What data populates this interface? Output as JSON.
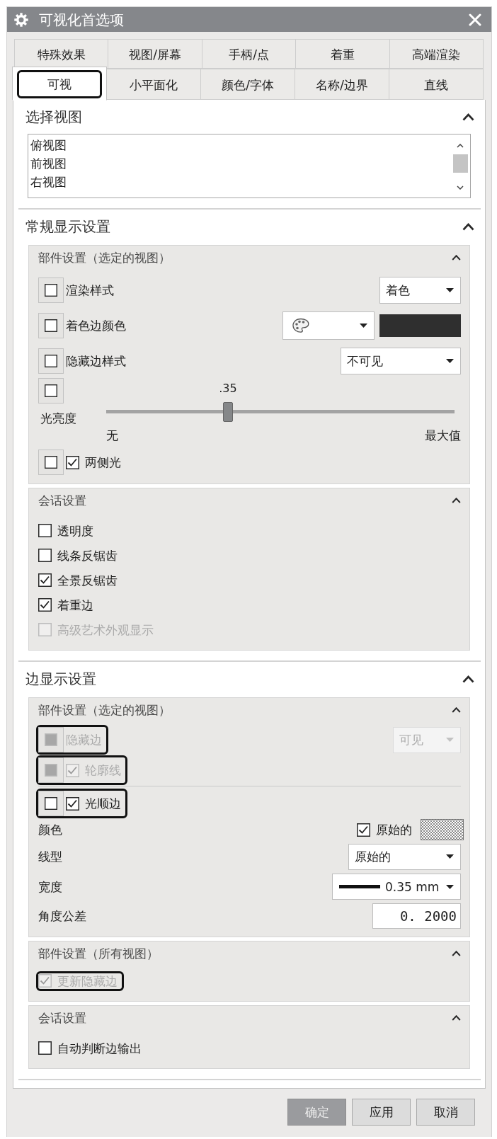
{
  "window": {
    "title": "可视化首选项"
  },
  "tab_rows": [
    {
      "tabs": [
        {
          "label": "特殊效果",
          "selected": false,
          "highlighted": false
        },
        {
          "label": "视图/屏幕",
          "selected": false,
          "highlighted": false
        },
        {
          "label": "手柄/点",
          "selected": false,
          "highlighted": false
        },
        {
          "label": "着重",
          "selected": false,
          "highlighted": false
        },
        {
          "label": "高端渲染",
          "selected": false,
          "highlighted": false
        }
      ]
    },
    {
      "tabs": [
        {
          "label": "可视",
          "selected": true,
          "highlighted": true
        },
        {
          "label": "小平面化",
          "selected": false,
          "highlighted": false
        },
        {
          "label": "颜色/字体",
          "selected": false,
          "highlighted": false
        },
        {
          "label": "名称/边界",
          "selected": false,
          "highlighted": false
        },
        {
          "label": "直线",
          "selected": false,
          "highlighted": false
        }
      ]
    }
  ],
  "sections": [
    {
      "kind": "list",
      "title": "选择视图",
      "expanded": true,
      "items": [
        "俯视图",
        "前视图",
        "右视图"
      ]
    },
    {
      "kind": "groups",
      "title": "常规显示设置",
      "expanded": true,
      "groups": [
        {
          "title": "部件设置（选定的视图）",
          "expanded": true,
          "rows": [
            {
              "kind": "toggle_dropdown",
              "toggle_checked": false,
              "label": "渲染样式",
              "value": "着色",
              "disabled": false
            },
            {
              "kind": "toggle_color",
              "toggle_checked": false,
              "label": "着色边颜色",
              "color": "#2f2f2f",
              "disabled": false
            },
            {
              "kind": "toggle_dropdown",
              "toggle_checked": false,
              "label": "隐藏边样式",
              "value": "不可见",
              "disabled": false
            },
            {
              "kind": "toggle_slider",
              "toggle_checked": false,
              "label": "光亮度",
              "reading": ".35",
              "level": 0.35,
              "min_label": "无",
              "max_label": "最大值"
            },
            {
              "kind": "toggle_check",
              "toggle_checked": false,
              "label": "两侧光",
              "checked": true,
              "disabled": false
            }
          ]
        },
        {
          "title": "会话设置",
          "expanded": true,
          "rows": [
            {
              "kind": "check",
              "label": "透明度",
              "checked": false,
              "disabled": false
            },
            {
              "kind": "check",
              "label": "线条反锯齿",
              "checked": false,
              "disabled": false
            },
            {
              "kind": "check",
              "label": "全景反锯齿",
              "checked": true,
              "disabled": false
            },
            {
              "kind": "check",
              "label": "着重边",
              "checked": true,
              "disabled": false
            },
            {
              "kind": "check",
              "label": "高级艺术外观显示",
              "checked": false,
              "disabled": true
            }
          ]
        }
      ]
    },
    {
      "kind": "groups",
      "title": "边显示设置",
      "expanded": true,
      "groups": [
        {
          "title": "部件设置（选定的视图）",
          "expanded": true,
          "rows": [
            {
              "kind": "toggle_dropdown",
              "toggle_checked": false,
              "label": "隐藏边",
              "value": "可见",
              "disabled": true,
              "highlighted": true
            },
            {
              "kind": "toggle_check",
              "toggle_checked": false,
              "label": "轮廓线",
              "checked": true,
              "disabled": true,
              "highlighted": true
            },
            {
              "kind": "separator"
            },
            {
              "kind": "toggle_check",
              "toggle_checked": false,
              "label": "光顺边",
              "checked": true,
              "disabled": false,
              "highlighted": true
            },
            {
              "kind": "color_option",
              "label": "颜色",
              "option_label": "原始的",
              "checked": true,
              "highlighted": false
            },
            {
              "kind": "dropdown",
              "label": "线型",
              "value": "原始的",
              "highlighted": false
            },
            {
              "kind": "line_width",
              "label": "宽度",
              "value": "0.35 mm",
              "highlighted": false
            },
            {
              "kind": "number",
              "label": "角度公差",
              "value": "0. 2000",
              "highlighted": false
            }
          ]
        },
        {
          "title": "部件设置（所有视图）",
          "expanded": true,
          "rows": [
            {
              "kind": "check",
              "label": "更新隐藏边",
              "checked": true,
              "disabled": true,
              "highlighted": true
            }
          ]
        },
        {
          "title": "会话设置",
          "expanded": true,
          "rows": [
            {
              "kind": "check",
              "label": "自动判断边输出",
              "checked": false,
              "disabled": false
            }
          ]
        }
      ]
    }
  ],
  "buttons": [
    {
      "label": "确定",
      "disabled": true
    },
    {
      "label": "应用",
      "disabled": false
    },
    {
      "label": "取消",
      "disabled": false
    }
  ]
}
